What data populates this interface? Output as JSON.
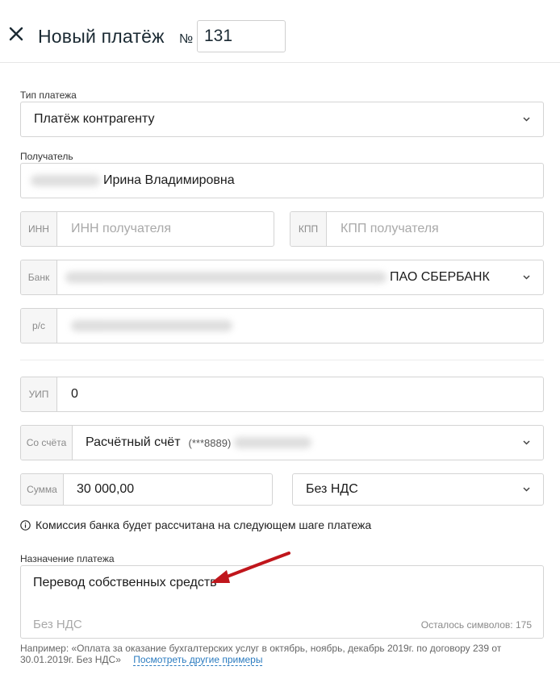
{
  "header": {
    "title": "Новый платёж",
    "number_sign": "№",
    "number_value": "131"
  },
  "payment_type": {
    "label": "Тип платежа",
    "value": "Платёж контрагенту"
  },
  "recipient": {
    "label": "Получатель",
    "value": "Ирина Владимировна"
  },
  "inn": {
    "prefix": "ИНН",
    "placeholder": "ИНН получателя"
  },
  "kpp": {
    "prefix": "КПП",
    "placeholder": "КПП получателя"
  },
  "bank": {
    "prefix": "Банк",
    "value": "ПАО СБЕРБАНК"
  },
  "account": {
    "prefix": "р/с"
  },
  "uip": {
    "prefix": "УИП",
    "value": "0"
  },
  "from_account": {
    "prefix": "Со счёта",
    "value": "Расчётный счёт",
    "masked": "(***8889)"
  },
  "amount": {
    "prefix": "Сумма",
    "value": "30 000,00"
  },
  "vat": {
    "value": "Без НДС"
  },
  "commission_note": "Комиссия банка будет рассчитана на следующем шаге платежа",
  "purpose": {
    "label": "Назначение платежа",
    "value": "Перевод собственных средств",
    "vat_line": "Без НДС",
    "counter": "Осталось символов: 175"
  },
  "hint": {
    "text": "Например: «Оплата за оказание бухгалтерских услуг в октябрь, ноябрь, декабрь 2019г. по договору 239 от 30.01.2019г. Без НДС»",
    "link": "Посмотреть другие примеры"
  },
  "colors": {
    "title": "#1b2a33",
    "link": "#2a7bc0",
    "arrow": "#c0161c",
    "border": "#d4d4d4"
  }
}
